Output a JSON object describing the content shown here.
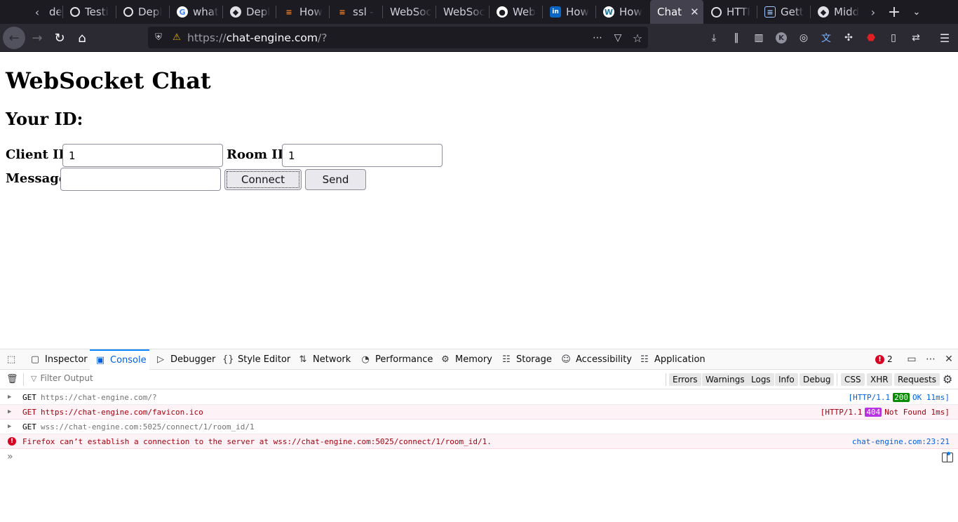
{
  "browser": {
    "tabs": [
      {
        "label": "de",
        "favicon": "generic"
      },
      {
        "label": "Testi",
        "favicon": "dark-circle"
      },
      {
        "label": "Depl",
        "favicon": "dark-circle"
      },
      {
        "label": "what",
        "favicon": "google"
      },
      {
        "label": "Depl",
        "favicon": "cube"
      },
      {
        "label": "How",
        "favicon": "stackoverflow"
      },
      {
        "label": "ssl -",
        "favicon": "stackoverflow"
      },
      {
        "label": "WebSoc",
        "favicon": "none"
      },
      {
        "label": "WebSoc",
        "favicon": "none"
      },
      {
        "label": "Web",
        "favicon": "github"
      },
      {
        "label": "How",
        "favicon": "linkedin"
      },
      {
        "label": "How",
        "favicon": "wordpress"
      },
      {
        "label": "Chat",
        "favicon": "none",
        "active": true
      },
      {
        "label": "HTTI",
        "favicon": "globe"
      },
      {
        "label": "Gett",
        "favicon": "book"
      },
      {
        "label": "Midd",
        "favicon": "cube"
      }
    ],
    "url": {
      "scheme": "https://",
      "host": "chat-engine.com",
      "path": "/?"
    }
  },
  "page": {
    "title": "WebSocket Chat",
    "your_id_label": "Your ID:",
    "client_id_label": "Client ID",
    "client_id_value": "1",
    "room_id_label": "Room ID",
    "room_id_value": "1",
    "message_label": "Message",
    "message_value": "",
    "connect_label": "Connect",
    "send_label": "Send"
  },
  "devtools": {
    "tabs": [
      "Inspector",
      "Console",
      "Debugger",
      "Style Editor",
      "Network",
      "Performance",
      "Memory",
      "Storage",
      "Accessibility",
      "Application"
    ],
    "active_tab": "Console",
    "error_count": "2",
    "filter_placeholder": "Filter Output",
    "filters": [
      "Errors",
      "Warnings",
      "Logs",
      "Info",
      "Debug"
    ],
    "request_filters": [
      "CSS",
      "XHR",
      "Requests"
    ],
    "logs": [
      {
        "method": "GET",
        "url": "https://chat-engine.com/?",
        "proto": "[HTTP/1.1",
        "code": "200",
        "status_text": "OK 11ms]",
        "error": false
      },
      {
        "method": "GET",
        "url": "https://chat-engine.com/favicon.ico",
        "proto": "[HTTP/1.1",
        "code": "404",
        "status_text": "Not Found 1ms]",
        "error": true
      },
      {
        "method": "GET",
        "url": "wss://chat-engine.com:5025/connect/1/room_id/1",
        "error": false
      }
    ],
    "error_message": "Firefox can’t establish a connection to the server at wss://chat-engine.com:5025/connect/1/room_id/1.",
    "error_source": "chat-engine.com:23:21"
  },
  "colors": {
    "tabbar_bg": "#1c1b22",
    "navbar_bg": "#2b2a33",
    "devtools_accent": "#0060df",
    "error_red": "#d70022",
    "ok_green": "#058b00",
    "notfound_purple": "#b833e1"
  }
}
